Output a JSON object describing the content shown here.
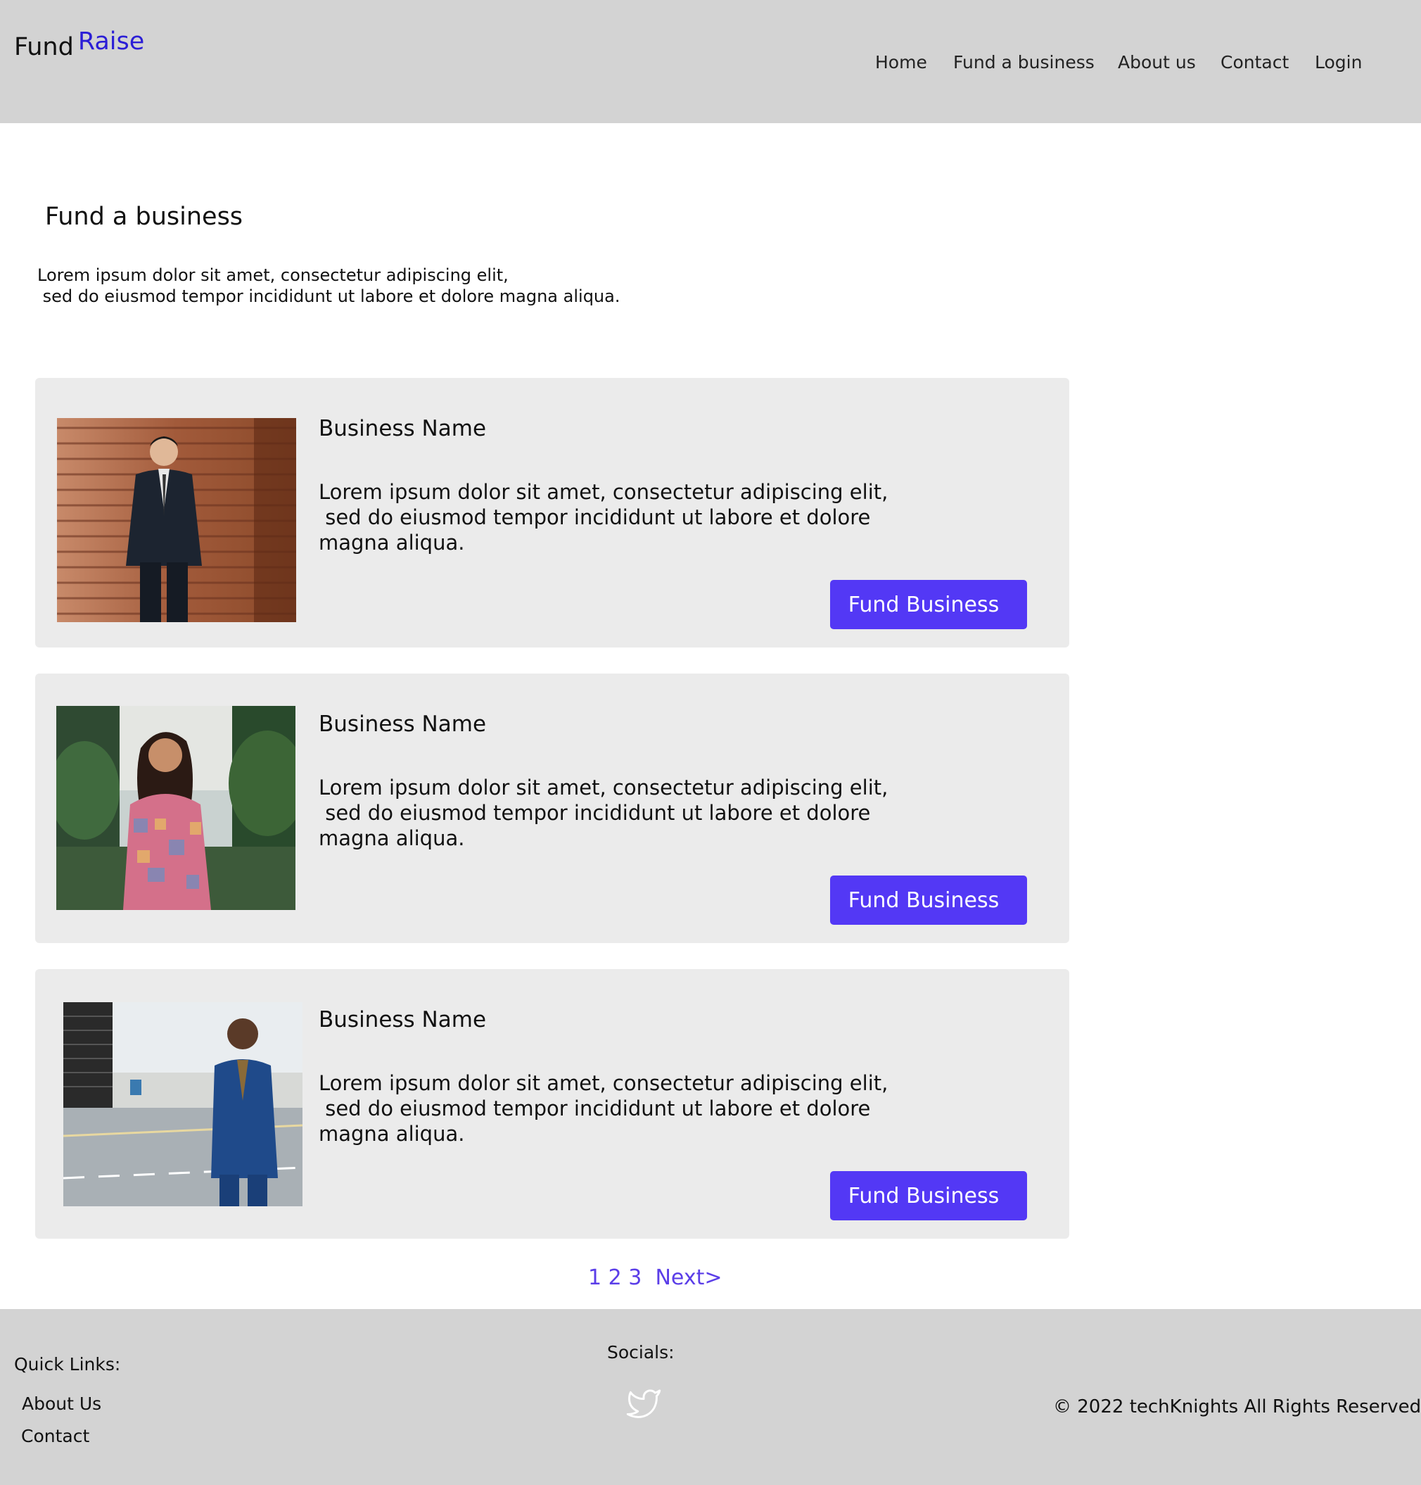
{
  "header": {
    "logo_part1": "Fund",
    "logo_part2": "Raise",
    "nav": [
      "Home",
      "Fund a business",
      "About us",
      "Contact",
      "Login"
    ]
  },
  "main": {
    "title": "Fund a business",
    "intro": "Lorem ipsum dolor sit amet, consectetur adipiscing elit,\n sed do eiusmod tempor incididunt ut labore et dolore magna aliqua.",
    "cards": [
      {
        "name": "Business Name",
        "description": "Lorem ipsum dolor sit amet, consectetur adipiscing elit,\n sed do eiusmod tempor incididunt ut labore et dolore\nmagna aliqua.",
        "button": "Fund Business"
      },
      {
        "name": "Business Name",
        "description": "Lorem ipsum dolor sit amet, consectetur adipiscing elit,\n sed do eiusmod tempor incididunt ut labore et dolore\nmagna aliqua.",
        "button": "Fund Business"
      },
      {
        "name": "Business Name",
        "description": "Lorem ipsum dolor sit amet, consectetur adipiscing elit,\n sed do eiusmod tempor incididunt ut labore et dolore\nmagna aliqua.",
        "button": "Fund Business"
      }
    ]
  },
  "pagination": {
    "pages": [
      "1",
      "2",
      "3"
    ],
    "next": "Next>"
  },
  "footer": {
    "quick_links_title": "Quick Links:",
    "quick_links": [
      "About Us",
      "Contact"
    ],
    "socials_title": "Socials:",
    "social_icon": "twitter-icon",
    "copyright": "© 2022 techKnights All Rights Reserved"
  },
  "colors": {
    "header_bg": "#d3d3d3",
    "accent": "#5338f5",
    "logo_accent": "#2b1ed6",
    "card_bg": "#ebebeb",
    "pagination": "#5b3ee8"
  }
}
